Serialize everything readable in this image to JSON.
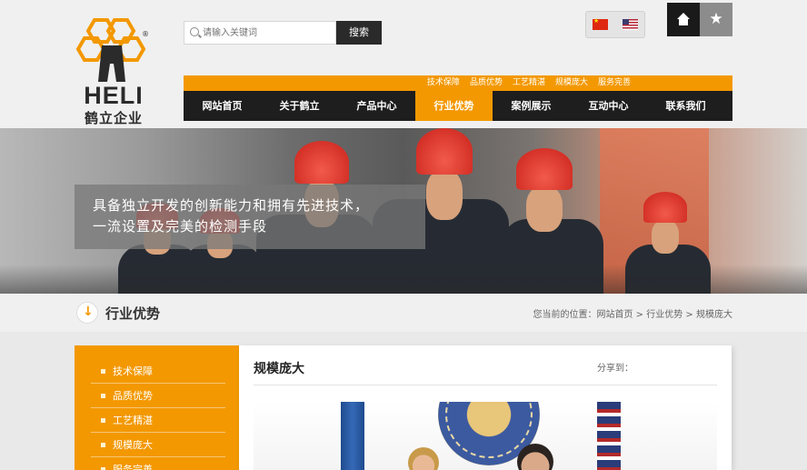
{
  "brand": {
    "logo_word": "HELI",
    "logo_cn": "鹤立企业",
    "registered": "®"
  },
  "search": {
    "placeholder": "请输入关键词",
    "button_label": "搜索"
  },
  "header_icons": {
    "star": "★"
  },
  "subnav": {
    "items": [
      "技术保障",
      "品质优势",
      "工艺精湛",
      "规模庞大",
      "服务完善"
    ]
  },
  "mainnav": {
    "items": [
      "网站首页",
      "关于鹤立",
      "产品中心",
      "行业优势",
      "案例展示",
      "互动中心",
      "联系我们"
    ],
    "active_index": 3
  },
  "banner": {
    "caption_line1": "具备独立开发的创新能力和拥有先进技术，",
    "caption_line2": "一流设置及完美的检测手段"
  },
  "section": {
    "title": "行业优势"
  },
  "breadcrumb": {
    "prefix": "您当前的位置：",
    "home": "网站首页",
    "sep": ">",
    "level1": "行业优势",
    "current": "规模庞大"
  },
  "sidebar": {
    "items": [
      "技术保障",
      "品质优势",
      "工艺精湛",
      "规模庞大",
      "服务完善"
    ]
  },
  "article": {
    "title": "规模庞大",
    "share_label": "分享到："
  },
  "colors": {
    "accent": "#f39800",
    "nav_dark": "#1e1e1e",
    "helmet_red": "#d4271c"
  }
}
